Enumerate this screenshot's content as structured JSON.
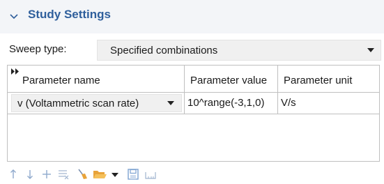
{
  "section": {
    "title": "Study Settings",
    "chevron_icon": "chevron-down-icon"
  },
  "sweep": {
    "label": "Sweep type:",
    "value": "Specified combinations"
  },
  "table": {
    "headers": {
      "name": "Parameter name",
      "value": "Parameter value",
      "unit": "Parameter unit"
    },
    "rows": [
      {
        "name": "v (Voltammetric scan rate)",
        "value": "10^range(-3,1,0)",
        "unit": "V/s"
      }
    ]
  },
  "toolbar": {
    "icons": [
      "move-up-icon",
      "move-down-icon",
      "add-icon",
      "delete-icon",
      "clear-table-icon",
      "load-from-file-icon",
      "load-dropdown-icon",
      "save-to-file-icon",
      "range-icon"
    ]
  },
  "colors": {
    "accent": "#2f5f9c",
    "header_bg": "#f3f5f8",
    "toolbar_icon": "#5a86bf",
    "folder": "#e8a33a"
  }
}
